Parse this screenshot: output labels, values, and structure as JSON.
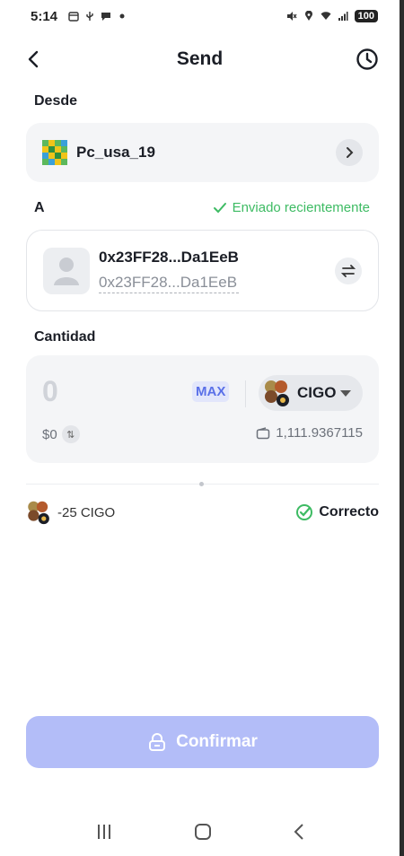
{
  "status_bar": {
    "time": "5:14",
    "battery": "100"
  },
  "header": {
    "title": "Send"
  },
  "from": {
    "label": "Desde",
    "wallet_name": "Pc_usa_19"
  },
  "to": {
    "label": "A",
    "recent_label": "Enviado recientemente",
    "address_name": "0x23FF28...Da1EeB",
    "address": "0x23FF28...Da1EeB"
  },
  "amount": {
    "label": "Cantidad",
    "value": "0",
    "max_label": "MAX",
    "token": "CIGO",
    "usd_value": "$0",
    "balance": "1,111.9367115"
  },
  "fee": {
    "text": "-25 CIGO",
    "status": "Correcto"
  },
  "confirm": {
    "label": "Confirmar"
  },
  "colors": {
    "accent": "#5a70e8",
    "confirm_disabled": "#b3bdf8",
    "success": "#3dbb63"
  }
}
